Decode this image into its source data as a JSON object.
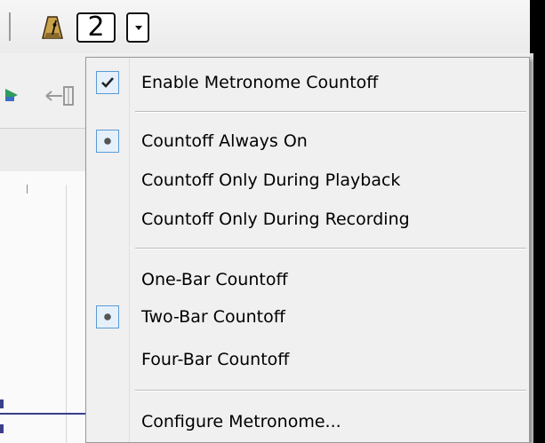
{
  "toolbar": {
    "countoff_bars_value": "2"
  },
  "menu": {
    "items": [
      {
        "label": "Enable Metronome Countoff",
        "mark": "check",
        "checked": true
      },
      {
        "label": "Countoff Always On",
        "mark": "radio",
        "checked": true
      },
      {
        "label": "Countoff Only During Playback",
        "mark": "radio",
        "checked": false
      },
      {
        "label": "Countoff Only During Recording",
        "mark": "radio",
        "checked": false
      },
      {
        "label": "One-Bar Countoff",
        "mark": "radio",
        "checked": false
      },
      {
        "label": "Two-Bar Countoff",
        "mark": "radio",
        "checked": true
      },
      {
        "label": "Four-Bar Countoff",
        "mark": "radio",
        "checked": false
      },
      {
        "label": "Configure Metronome...",
        "mark": "none",
        "checked": false
      }
    ]
  },
  "icons": {
    "metronome": "metronome-icon",
    "dropdown": "chevron-down-icon",
    "check": "check-icon",
    "radio": "radio-dot-icon",
    "play": "play-icon",
    "insert": "insert-icon"
  },
  "colors": {
    "menu_bg": "#f0f0f0",
    "mark_border": "#5a9ad6",
    "mark_fill": "#e6f0fa"
  }
}
